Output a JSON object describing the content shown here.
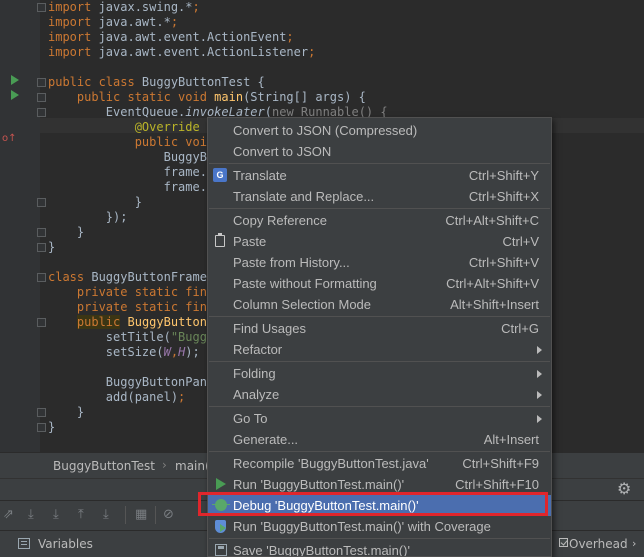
{
  "editor": {
    "lines": [
      {
        "parts": [
          {
            "t": "import ",
            "c": "kw"
          },
          {
            "t": "javax.swing.*",
            "c": ""
          },
          {
            "t": ";",
            "c": "kw"
          }
        ]
      },
      {
        "parts": [
          {
            "t": "import ",
            "c": "kw"
          },
          {
            "t": "java.awt.*",
            "c": ""
          },
          {
            "t": ";",
            "c": "kw"
          }
        ]
      },
      {
        "parts": [
          {
            "t": "import ",
            "c": "kw"
          },
          {
            "t": "java.awt.event.ActionEvent",
            "c": ""
          },
          {
            "t": ";",
            "c": "kw"
          }
        ]
      },
      {
        "parts": [
          {
            "t": "import ",
            "c": "kw"
          },
          {
            "t": "java.awt.event.ActionListener",
            "c": ""
          },
          {
            "t": ";",
            "c": "kw"
          }
        ]
      },
      {
        "parts": []
      },
      {
        "parts": [
          {
            "t": "public class ",
            "c": "kw"
          },
          {
            "t": "BuggyButtonTest {",
            "c": ""
          }
        ]
      },
      {
        "parts": [
          {
            "t": "    public static void ",
            "c": "kw"
          },
          {
            "t": "main",
            "c": "fn"
          },
          {
            "t": "(String[] args) {",
            "c": ""
          }
        ]
      },
      {
        "parts": [
          {
            "t": "        EventQueue.",
            "c": ""
          },
          {
            "t": "invokeLater",
            "c": "it"
          },
          {
            "t": "(",
            "c": ""
          },
          {
            "t": "new Runnable() {",
            "c": "gray"
          }
        ]
      },
      {
        "parts": [
          {
            "t": "            ",
            "c": ""
          },
          {
            "t": "@Override",
            "c": "ann"
          }
        ]
      },
      {
        "parts": [
          {
            "t": "            public void",
            "c": "kw"
          }
        ]
      },
      {
        "parts": [
          {
            "t": "                BuggyBu",
            "c": ""
          }
        ]
      },
      {
        "parts": [
          {
            "t": "                frame.s",
            "c": ""
          }
        ]
      },
      {
        "parts": [
          {
            "t": "                frame.s",
            "c": ""
          }
        ]
      },
      {
        "parts": [
          {
            "t": "            }",
            "c": ""
          }
        ]
      },
      {
        "parts": [
          {
            "t": "        });",
            "c": ""
          }
        ]
      },
      {
        "parts": [
          {
            "t": "    }",
            "c": ""
          }
        ]
      },
      {
        "parts": [
          {
            "t": "}",
            "c": ""
          }
        ]
      },
      {
        "parts": []
      },
      {
        "parts": [
          {
            "t": "class ",
            "c": "kw"
          },
          {
            "t": "BuggyButtonFrame",
            "c": ""
          }
        ]
      },
      {
        "parts": [
          {
            "t": "    private static fina",
            "c": "kw"
          }
        ]
      },
      {
        "parts": [
          {
            "t": "    private static fina",
            "c": "kw"
          }
        ]
      },
      {
        "parts": [
          {
            "t": "    ",
            "c": ""
          },
          {
            "t": "public",
            "c": "kw kwbox"
          },
          {
            "t": " ",
            "c": ""
          },
          {
            "t": "BuggyButtonF",
            "c": "fn"
          }
        ]
      },
      {
        "parts": [
          {
            "t": "        setTitle(",
            "c": ""
          },
          {
            "t": "\"Buggy",
            "c": "str"
          }
        ]
      },
      {
        "parts": [
          {
            "t": "        setSize(",
            "c": ""
          },
          {
            "t": "W",
            "c": "fld"
          },
          {
            "t": ",",
            "c": "kw"
          },
          {
            "t": "H",
            "c": "fld"
          },
          {
            "t": ");",
            "c": ""
          }
        ]
      },
      {
        "parts": []
      },
      {
        "parts": [
          {
            "t": "        BuggyButtonPane",
            "c": ""
          }
        ]
      },
      {
        "parts": [
          {
            "t": "        add(panel)",
            "c": ""
          },
          {
            "t": ";",
            "c": "kw"
          }
        ]
      },
      {
        "parts": [
          {
            "t": "    }",
            "c": ""
          }
        ]
      },
      {
        "parts": [
          {
            "t": "}",
            "c": ""
          }
        ]
      }
    ]
  },
  "breadcrumb": {
    "class_name": "BuggyButtonTest",
    "separator": "›",
    "method_name": "main()"
  },
  "toolbar": {
    "icons": [
      "⇗",
      "⤓",
      "⤓",
      "⤒",
      "⤓",
      "▦",
      "⊘"
    ]
  },
  "debug_panel": {
    "title": "Variables",
    "overhead_label": "Overhead",
    "overhead_checked": true
  },
  "context_menu": {
    "items": [
      {
        "label": "Convert to JSON (Compressed)",
        "shortcut": "",
        "icon": "",
        "submenu": false
      },
      {
        "label": "Convert to JSON",
        "shortcut": "",
        "icon": "",
        "submenu": false
      },
      {
        "separator": true
      },
      {
        "label": "Translate",
        "shortcut": "Ctrl+Shift+Y",
        "icon": "translate",
        "submenu": false
      },
      {
        "label": "Translate and Replace...",
        "shortcut": "Ctrl+Shift+X",
        "icon": "",
        "submenu": false
      },
      {
        "separator": true
      },
      {
        "label": "Copy Reference",
        "shortcut": "Ctrl+Alt+Shift+C",
        "icon": "",
        "submenu": false
      },
      {
        "label": "Paste",
        "shortcut": "Ctrl+V",
        "icon": "paste",
        "submenu": false
      },
      {
        "label": "Paste from History...",
        "shortcut": "Ctrl+Shift+V",
        "icon": "",
        "submenu": false
      },
      {
        "label": "Paste without Formatting",
        "shortcut": "Ctrl+Alt+Shift+V",
        "icon": "",
        "submenu": false
      },
      {
        "label": "Column Selection Mode",
        "shortcut": "Alt+Shift+Insert",
        "icon": "",
        "submenu": false
      },
      {
        "separator": true
      },
      {
        "label": "Find Usages",
        "shortcut": "Ctrl+G",
        "icon": "",
        "submenu": false
      },
      {
        "label": "Refactor",
        "shortcut": "",
        "icon": "",
        "submenu": true
      },
      {
        "separator": true
      },
      {
        "label": "Folding",
        "shortcut": "",
        "icon": "",
        "submenu": true
      },
      {
        "label": "Analyze",
        "shortcut": "",
        "icon": "",
        "submenu": true
      },
      {
        "separator": true
      },
      {
        "label": "Go To",
        "shortcut": "",
        "icon": "",
        "submenu": true
      },
      {
        "label": "Generate...",
        "shortcut": "Alt+Insert",
        "icon": "",
        "submenu": false
      },
      {
        "separator": true
      },
      {
        "label": "Recompile 'BuggyButtonTest.java'",
        "shortcut": "Ctrl+Shift+F9",
        "icon": "",
        "submenu": false
      },
      {
        "label": "Run 'BuggyButtonTest.main()'",
        "shortcut": "Ctrl+Shift+F10",
        "icon": "run",
        "submenu": false
      },
      {
        "label": "Debug 'BuggyButtonTest.main()'",
        "shortcut": "",
        "icon": "debug",
        "submenu": false,
        "selected": true,
        "highlighted": true
      },
      {
        "label": "Run 'BuggyButtonTest.main()' with Coverage",
        "shortcut": "",
        "icon": "coverage",
        "submenu": false
      },
      {
        "separator": true
      },
      {
        "label": "Save 'BuggyButtonTest.main()'",
        "shortcut": "",
        "icon": "save",
        "submenu": false
      }
    ]
  },
  "colors": {
    "editor_bg": "#2b2b2b",
    "menu_bg": "#3c3f41",
    "selection": "#4b6eaf",
    "highlight_outline": "#e0262c",
    "keyword": "#cc7832",
    "function": "#ffc66d",
    "annotation": "#bbb529",
    "string": "#6a8759",
    "run_green": "#499c54"
  }
}
